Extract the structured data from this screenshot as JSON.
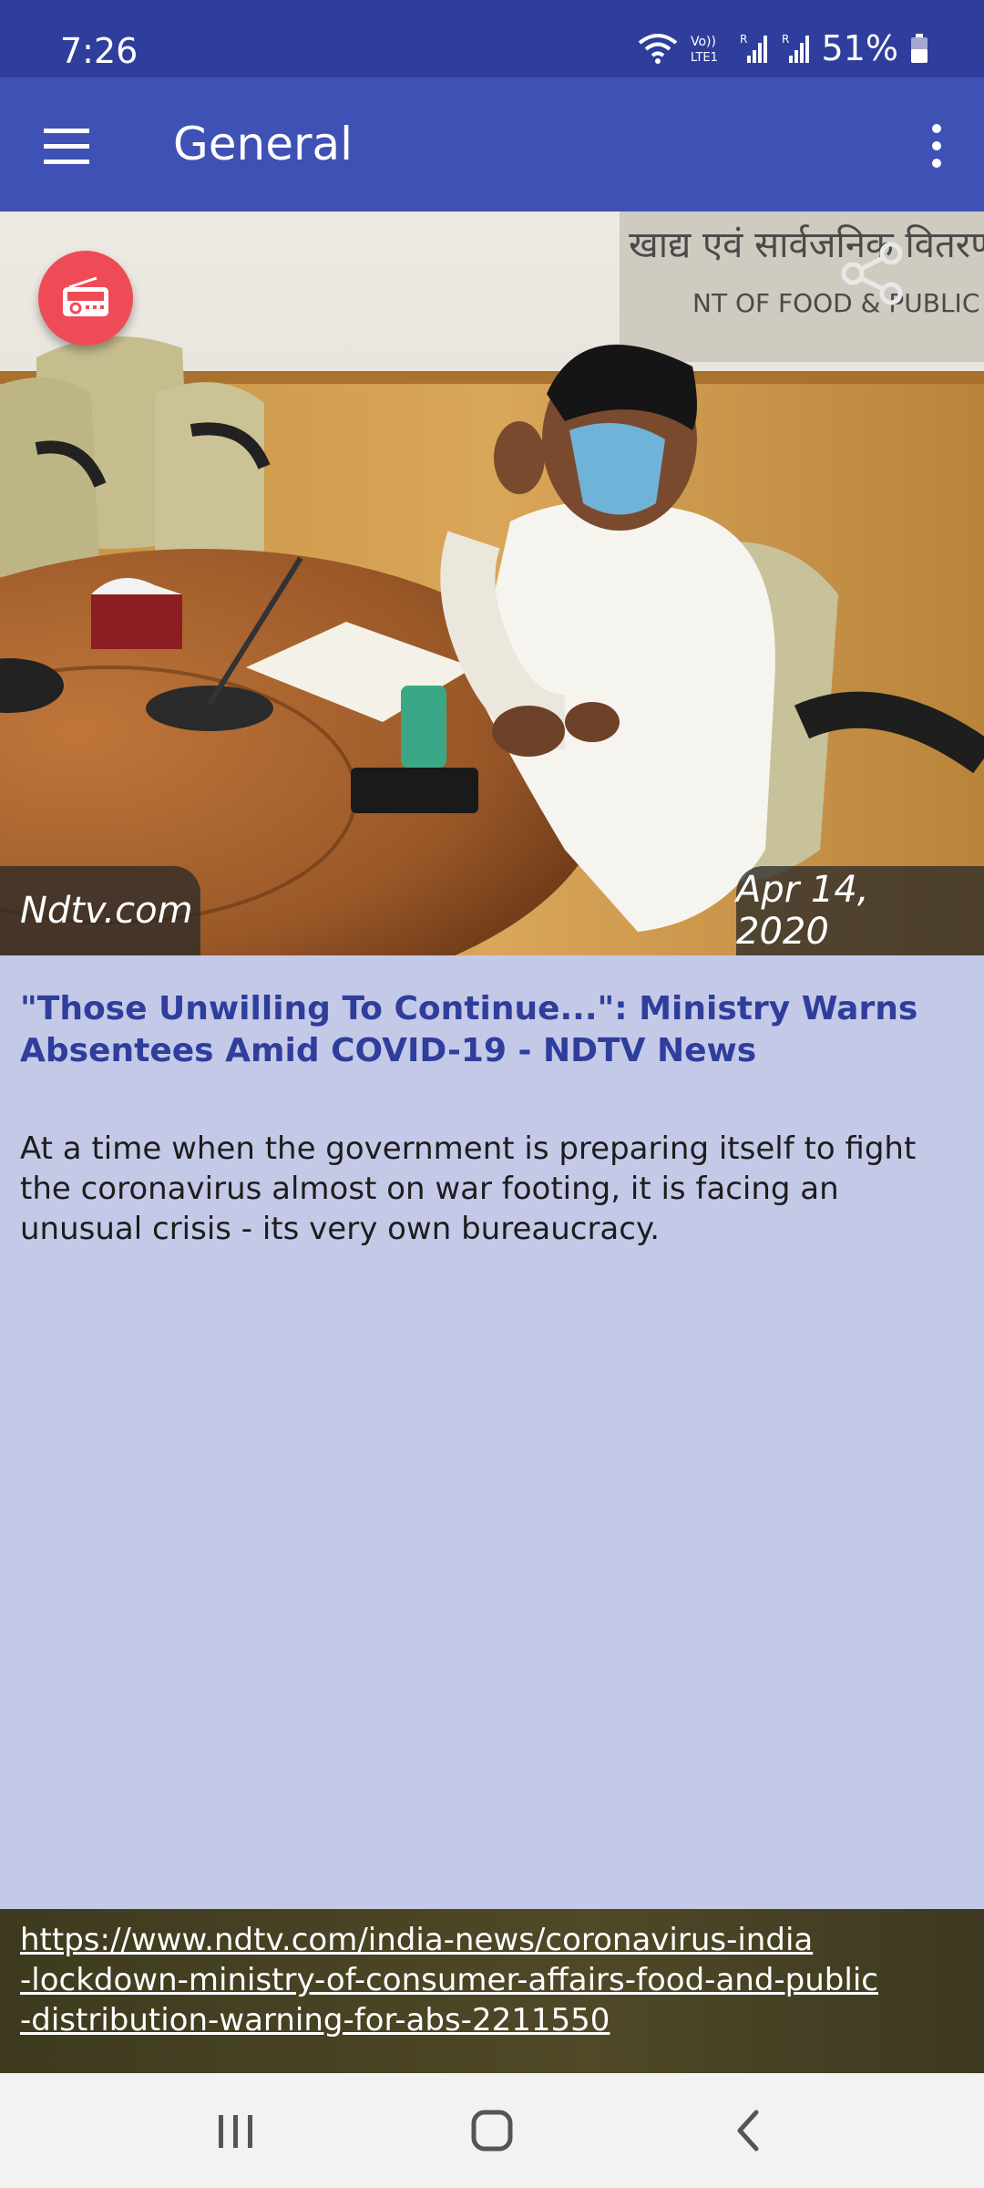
{
  "status_bar": {
    "time": "7:26",
    "battery": "51%",
    "icons": [
      "wifi-icon",
      "volte-icon",
      "signal-icon",
      "signal-icon",
      "battery-icon"
    ]
  },
  "app_bar": {
    "title": "General",
    "menu_icon": "hamburger-menu-icon",
    "overflow_icon": "more-vert-icon"
  },
  "article": {
    "source": "Ndtv.com",
    "date": "Apr 14, 2020",
    "headline": "\"Those Unwilling To Continue...\": Ministry Warns Absentees Amid COVID-19 - NDTV News",
    "summary": "At a time when the government is preparing itself to fight the coronavirus almost on war footing, it is facing an unusual crisis - its very own bureaucracy.",
    "url_line1": "https://www.ndtv.com/india-news/coronavirus-india",
    "url_line2": "-lockdown-ministry-of-consumer-affairs-food-and-public",
    "url_line3": "-distribution-warning-for-abs-2211550",
    "sign_text_line1": "खाद्य एवं सार्वजनिक वितरण विभाग",
    "sign_text_line2": "NT OF FOOD & PUBLIC DISTRIBUTION"
  },
  "colors": {
    "status_bar": "#2f3e9c",
    "app_bar": "#3f51b5",
    "page_background": "#c5c9e8",
    "headline": "#2f3e9c",
    "radio_button": "#ef4b57"
  },
  "nav_bar": {
    "icons": [
      "recent-apps-icon",
      "home-icon",
      "back-icon"
    ]
  }
}
